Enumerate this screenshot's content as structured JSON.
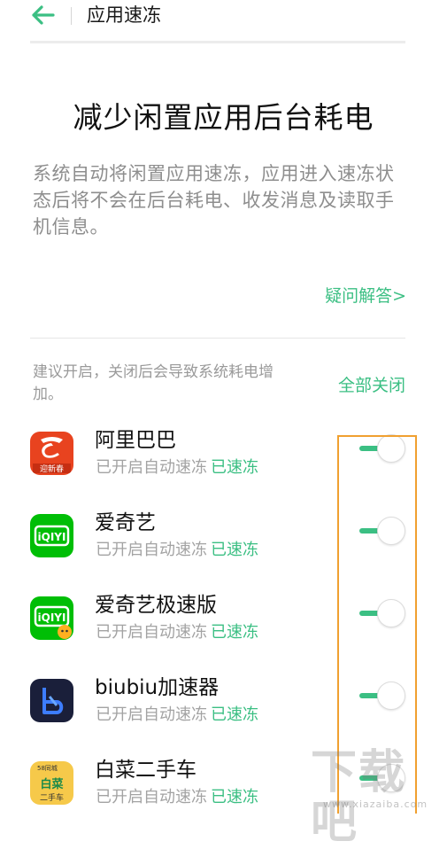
{
  "header": {
    "back_icon": "arrow-left-icon",
    "title": "应用速冻"
  },
  "intro": {
    "headline": "减少闲置应用后台耗电",
    "description": "系统自动将闲置应用速冻，应用进入速冻状态后将不会在后台耗电、收发消息及读取手机信息。",
    "faq_link": "疑问解答>"
  },
  "list_header": {
    "tip": "建议开启，关闭后会导致系统耗电增加。",
    "close_all": "全部关闭"
  },
  "apps": [
    {
      "name": "阿里巴巴",
      "status": "已开启自动速冻",
      "state": "已速冻",
      "enabled": true,
      "icon": "alibaba-icon",
      "icon_text": "迎新春"
    },
    {
      "name": "爱奇艺",
      "status": "已开启自动速冻",
      "state": "已速冻",
      "enabled": true,
      "icon": "iqiyi-icon",
      "icon_text": "iQIYI"
    },
    {
      "name": "爱奇艺极速版",
      "status": "已开启自动速冻",
      "state": "已速冻",
      "enabled": true,
      "icon": "iqiyi-lite-icon",
      "icon_text": "iQIYI"
    },
    {
      "name": "biubiu加速器",
      "status": "已开启自动速冻",
      "state": "已速冻",
      "enabled": true,
      "icon": "biubiu-icon",
      "icon_text": ""
    },
    {
      "name": "白菜二手车",
      "status": "已开启自动速冻",
      "state": "已速冻",
      "enabled": true,
      "icon": "baicai-icon",
      "icon_text": "白菜二手车",
      "icon_badge": "58同城"
    }
  ],
  "watermark": {
    "text": "下载吧",
    "url": "www.xiazaiba.com"
  },
  "colors": {
    "accent": "#3bbf83",
    "highlight": "#f0a030",
    "alibaba": "#e8431f",
    "iqiyi": "#00be06",
    "biubiu": "#1a1f3a",
    "baicai": "#f6c94a"
  }
}
